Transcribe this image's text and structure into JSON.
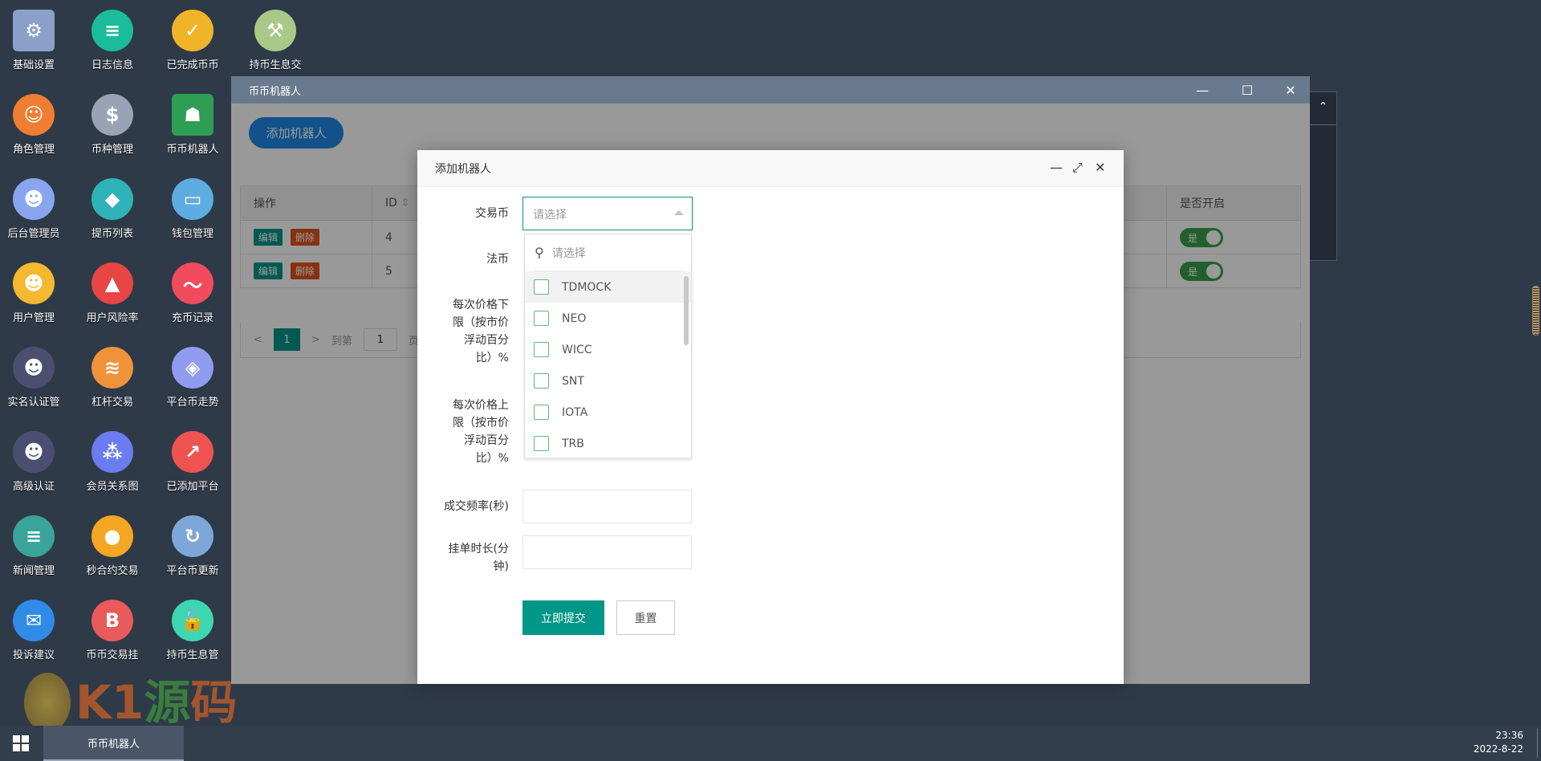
{
  "desktop_icons": [
    {
      "label": "基础设置",
      "icon": "gear-icon",
      "color": "#8aa0c8",
      "glyph": "⚙"
    },
    {
      "label": "日志信息",
      "icon": "log-clock-icon",
      "color": "#1abc9c",
      "glyph": "≡"
    },
    {
      "label": "已完成币币",
      "icon": "check-box-icon",
      "color": "#f0b429",
      "glyph": "✓"
    },
    {
      "label": "持币生息交",
      "icon": "hammer-icon",
      "color": "#a8c987",
      "glyph": "⚒"
    },
    {
      "label": "角色管理",
      "icon": "roles-icon",
      "color": "#ef7d32",
      "glyph": "☺"
    },
    {
      "label": "币种管理",
      "icon": "dollar-icon",
      "color": "#9aa3b5",
      "glyph": "$"
    },
    {
      "label": "币币机器人",
      "icon": "robot-icon",
      "color": "#2e9e52",
      "glyph": "☗"
    },
    {
      "label": "后台管理员",
      "icon": "admin-icon",
      "color": "#8aa5f0",
      "glyph": "☻"
    },
    {
      "label": "提币列表",
      "icon": "coins-icon",
      "color": "#2fb3b8",
      "glyph": "◆"
    },
    {
      "label": "钱包管理",
      "icon": "wallet-icon",
      "color": "#5dade2",
      "glyph": "▭"
    },
    {
      "label": "用户管理",
      "icon": "user-search-icon",
      "color": "#f5b82e",
      "glyph": "☻"
    },
    {
      "label": "用户风险率",
      "icon": "alarm-icon",
      "color": "#e84545",
      "glyph": "▲"
    },
    {
      "label": "充币记录",
      "icon": "phone-chart-icon",
      "color": "#f24b5e",
      "glyph": "〜"
    },
    {
      "label": "实名认证管",
      "icon": "verify-user-icon",
      "color": "#4a4f72",
      "glyph": "☻"
    },
    {
      "label": "杠杆交易",
      "icon": "layers-icon",
      "color": "#f0923a",
      "glyph": "≋"
    },
    {
      "label": "平台币走势",
      "icon": "stack-icon",
      "color": "#8f9cf0",
      "glyph": "◈"
    },
    {
      "label": "高级认证",
      "icon": "advanced-verify-icon",
      "color": "#4a4f72",
      "glyph": "☻"
    },
    {
      "label": "会员关系图",
      "icon": "network-icon",
      "color": "#6b7cf0",
      "glyph": "⁂"
    },
    {
      "label": "已添加平台",
      "icon": "trend-icon",
      "color": "#ef5350",
      "glyph": "↗"
    },
    {
      "label": "新闻管理",
      "icon": "news-icon",
      "color": "#3aa39a",
      "glyph": "≡"
    },
    {
      "label": "秒合约交易",
      "icon": "stopwatch-icon",
      "color": "#f5a623",
      "glyph": "●"
    },
    {
      "label": "平台币更新",
      "icon": "cloud-refresh-icon",
      "color": "#7da7d9",
      "glyph": "↻"
    },
    {
      "label": "投诉建议",
      "icon": "mail-icon",
      "color": "#2f8be6",
      "glyph": "✉"
    },
    {
      "label": "币币交易挂",
      "icon": "bitcoin-icon",
      "color": "#e95a5a",
      "glyph": "B"
    },
    {
      "label": "持币生息管",
      "icon": "unlock-icon",
      "color": "#3ed6b0",
      "glyph": "🔓"
    }
  ],
  "window": {
    "title": "币币机器人",
    "add_button": "添加机器人",
    "table": {
      "headers": [
        "操作",
        "ID",
        "是否开启"
      ],
      "edit": "编辑",
      "delete": "删除",
      "rows": [
        {
          "id": "4",
          "enabled": "是"
        },
        {
          "id": "5",
          "enabled": "是"
        }
      ]
    },
    "pager": {
      "current": "1",
      "goto": "到第",
      "page_input": "1",
      "page_suffix": "页"
    }
  },
  "modal": {
    "title": "添加机器人",
    "fields": {
      "coin": "交易币",
      "fiat": "法币",
      "lower": [
        "每次价格下",
        "限（按市价",
        "浮动百分",
        "比）%"
      ],
      "upper": [
        "每次价格上",
        "限（按市价",
        "浮动百分",
        "比）%"
      ],
      "freq": "成交频率(秒)",
      "duration": [
        "挂单时长(分",
        "钟)"
      ]
    },
    "select_placeholder": "请选择",
    "search_placeholder": "请选择",
    "options": [
      "TDMOCK",
      "NEO",
      "WICC",
      "SNT",
      "IOTA",
      "TRB"
    ],
    "submit": "立即提交",
    "reset": "重置"
  },
  "taskbar": {
    "task": "币币机器人",
    "time": "23:36",
    "date": "2022-8-22"
  },
  "watermark": {
    "text": "K1源码",
    "url": "k1ym.com"
  }
}
